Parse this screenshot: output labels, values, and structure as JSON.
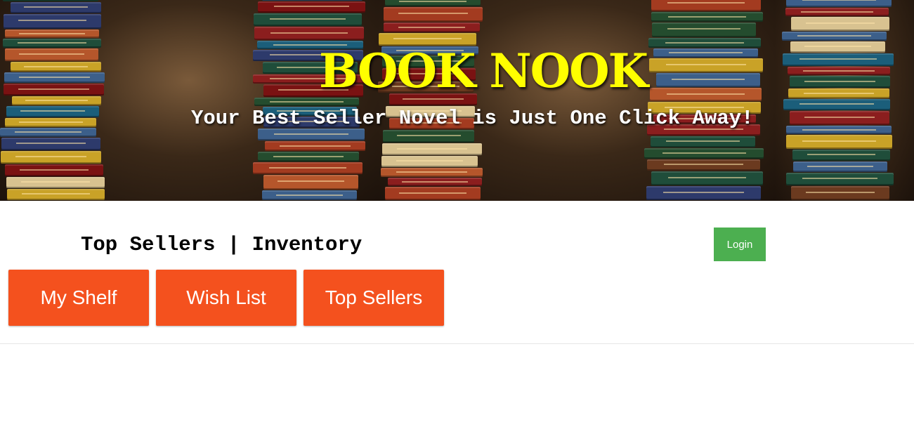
{
  "hero": {
    "title": "BOOK NOOK",
    "tagline": "Your Best Seller Novel is Just One Click Away!"
  },
  "nav": {
    "heading": "Top Sellers | Inventory"
  },
  "login": {
    "label": "Login"
  },
  "tabs": [
    {
      "label": "My Shelf"
    },
    {
      "label": "Wish List"
    },
    {
      "label": "Top Sellers"
    }
  ],
  "colors": {
    "title": "#ffff00",
    "login": "#4caf50",
    "tab": "#f4511e"
  }
}
